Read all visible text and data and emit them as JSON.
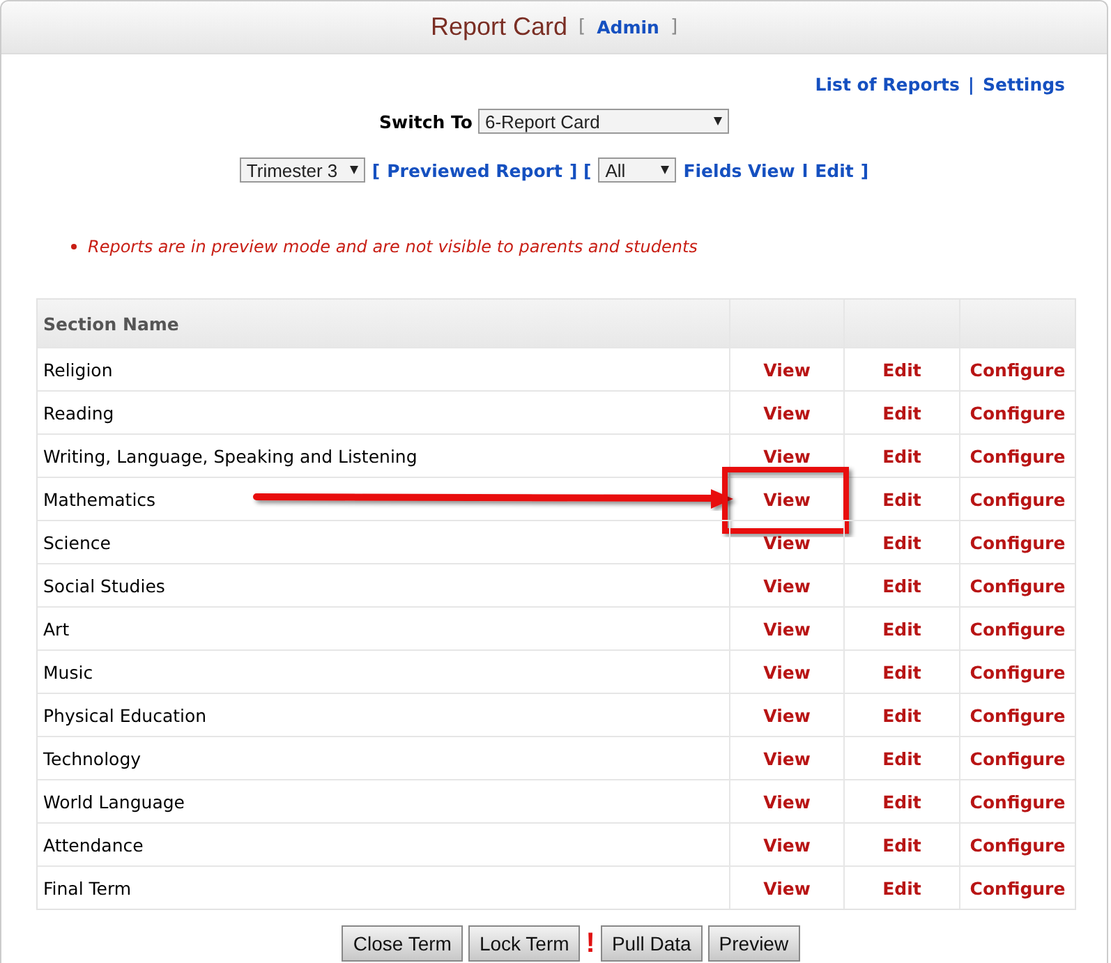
{
  "window": {
    "title": "Report Card",
    "role_link": "Admin",
    "bracket_open": "[",
    "bracket_close": "]"
  },
  "top_links": [
    "List of Reports",
    "Settings"
  ],
  "top_links_separator": "|",
  "switch_to": {
    "label": "Switch To",
    "value": "6-Report Card"
  },
  "filters": [
    {
      "kind": "dropdown",
      "text": "Trimester 3"
    },
    {
      "kind": "bracket",
      "text": "["
    },
    {
      "kind": "link",
      "text": "Previewed Report"
    },
    {
      "kind": "bracket",
      "text": "] ["
    },
    {
      "kind": "dropdown",
      "text": "All"
    },
    {
      "kind": "link",
      "text": "Fields View"
    },
    {
      "kind": "bracket",
      "text": "l"
    },
    {
      "kind": "link",
      "text": "Edit"
    },
    {
      "kind": "bracket",
      "text": "]"
    }
  ],
  "notice": "Reports are in preview mode and are not visible to parents and students",
  "table": {
    "columns": [
      "Section Name"
    ],
    "rows": [
      {
        "name": "Religion",
        "view": "View",
        "edit": "Edit",
        "configure": "Configure",
        "highlighted": false
      },
      {
        "name": "Reading",
        "view": "View",
        "edit": "Edit",
        "configure": "Configure",
        "highlighted": false
      },
      {
        "name": "Writing, Language, Speaking and Listening",
        "view": "View",
        "edit": "Edit",
        "configure": "Configure",
        "highlighted": false
      },
      {
        "name": "Mathematics",
        "view": "View",
        "edit": "Edit",
        "configure": "Configure",
        "highlighted": true
      },
      {
        "name": "Science",
        "view": "View",
        "edit": "Edit",
        "configure": "Configure",
        "highlighted": false
      },
      {
        "name": "Social Studies",
        "view": "View",
        "edit": "Edit",
        "configure": "Configure",
        "highlighted": false
      },
      {
        "name": "Art",
        "view": "View",
        "edit": "Edit",
        "configure": "Configure",
        "highlighted": false
      },
      {
        "name": "Music",
        "view": "View",
        "edit": "Edit",
        "configure": "Configure",
        "highlighted": false
      },
      {
        "name": "Physical Education",
        "view": "View",
        "edit": "Edit",
        "configure": "Configure",
        "highlighted": false
      },
      {
        "name": "Technology",
        "view": "View",
        "edit": "Edit",
        "configure": "Configure",
        "highlighted": false
      },
      {
        "name": "World Language",
        "view": "View",
        "edit": "Edit",
        "configure": "Configure",
        "highlighted": false
      },
      {
        "name": "Attendance",
        "view": "View",
        "edit": "Edit",
        "configure": "Configure",
        "highlighted": false
      },
      {
        "name": "Final Term",
        "view": "View",
        "edit": "Edit",
        "configure": "Configure",
        "highlighted": false
      }
    ]
  },
  "buttons": [
    {
      "kind": "button",
      "label": "Close Term"
    },
    {
      "kind": "button",
      "label": "Lock Term"
    },
    {
      "kind": "warning",
      "label": "!"
    },
    {
      "kind": "button",
      "label": "Pull Data"
    },
    {
      "kind": "button",
      "label": "Preview"
    }
  ]
}
